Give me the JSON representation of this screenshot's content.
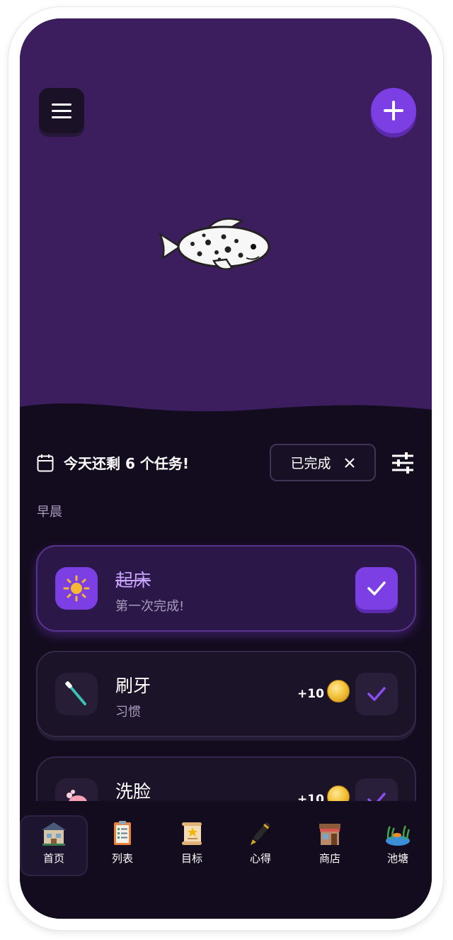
{
  "header": {
    "menu_icon": "hamburger-menu-icon",
    "add_icon": "plus-icon",
    "mascot": "koi-fish-image"
  },
  "task_bar": {
    "calendar_icon": "calendar-icon",
    "remaining_text": "今天还剩 6 个任务!",
    "done_filter_label": "已完成",
    "done_filter_clear_icon": "close-icon",
    "filter_icon": "sliders-icon"
  },
  "section": {
    "label": "早晨"
  },
  "tasks": [
    {
      "title": "起床",
      "subtitle": "第一次完成!",
      "icon": "sun-icon",
      "completed": true,
      "reward": ""
    },
    {
      "title": "刷牙",
      "subtitle": "习惯",
      "icon": "toothbrush-icon",
      "completed": false,
      "reward": "+10"
    },
    {
      "title": "洗脸",
      "subtitle": "",
      "icon": "soap-icon",
      "completed": false,
      "reward": "+10"
    }
  ],
  "nav": [
    {
      "label": "首页",
      "icon": "house-icon",
      "selected": true
    },
    {
      "label": "列表",
      "icon": "clipboard-list-icon",
      "selected": false
    },
    {
      "label": "目标",
      "icon": "scroll-star-icon",
      "selected": false
    },
    {
      "label": "心得",
      "icon": "pen-icon",
      "selected": false
    },
    {
      "label": "商店",
      "icon": "shop-icon",
      "selected": false
    },
    {
      "label": "池塘",
      "icon": "pond-icon",
      "selected": false
    }
  ],
  "colors": {
    "hero_bg": "#3c1d5e",
    "screen_bg": "#130c1e",
    "accent": "#7b3fe4"
  }
}
